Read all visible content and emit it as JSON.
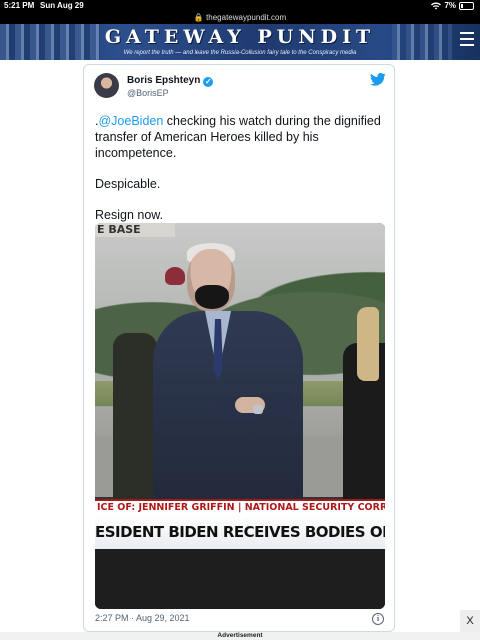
{
  "status_bar": {
    "time": "5:21 PM",
    "date": "Sun Aug 29",
    "battery": "7%"
  },
  "browser": {
    "url": "thegatewaypundit.com"
  },
  "site": {
    "title": "GATEWAY PUNDIT",
    "tagline": "We report the truth — and leave the Russia-Collusion fairy tale to the Conspiracy media"
  },
  "tweet": {
    "author_name": "Boris Epshteyn",
    "author_handle": "@BorisEP",
    "mention": "@JoeBiden",
    "line1_prefix": ".",
    "line1_rest": " checking his watch during the dignified transfer of American Heroes killed by his incompetence.",
    "line2": "Despicable.",
    "line3": "Resign now.",
    "timestamp": "2:27 PM · Aug 29, 2021"
  },
  "image_overlay": {
    "sign_text": "E BASE",
    "lower_third_left": "ICE OF: JENNIFER GRIFFIN",
    "lower_third_right": " | NATIONAL SECURITY CORR",
    "headline": "ESIDENT BIDEN RECEIVES BODIES OF FALLEN"
  },
  "ad": {
    "label": "Advertisement",
    "close": "X"
  }
}
